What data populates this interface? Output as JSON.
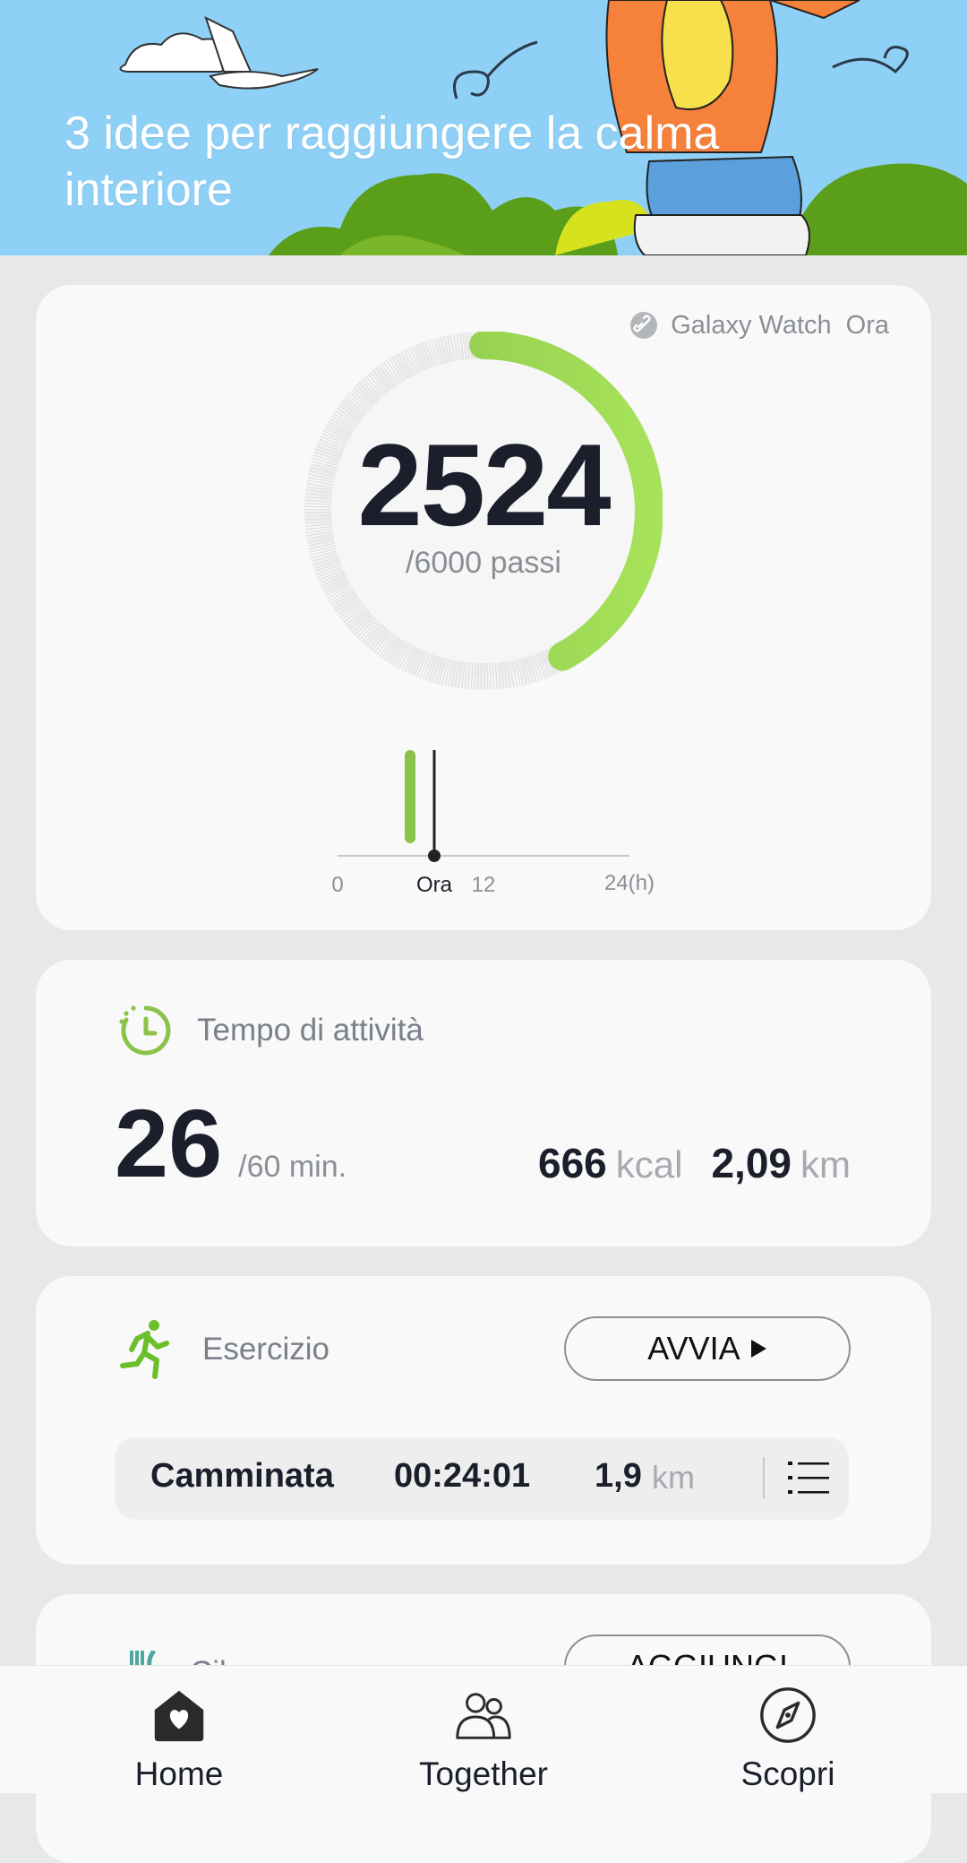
{
  "banner": {
    "headline": "3 idee per raggiungere la calma interiore",
    "colors": {
      "sky": "#8fd0f6",
      "bush": "#5a9e1a",
      "shirt": "#f5813a",
      "hair": "#f6e04b",
      "jeans": "#5ba0dc"
    }
  },
  "steps": {
    "source_device": "Galaxy Watch",
    "source_time": "Ora",
    "count": "2524",
    "goal_text": "/6000 passi",
    "progress": 0.4207,
    "timeline": {
      "labels": [
        "0",
        "Ora",
        "12",
        "24(h)"
      ],
      "now_hour": 7
    },
    "accent_color": "#8bc34a"
  },
  "active_time": {
    "title": "Tempo di attività",
    "value": "26",
    "goal_text": "/60 min.",
    "kcal_value": "666",
    "kcal_unit": "kcal",
    "distance_value": "2,09",
    "distance_unit": "km"
  },
  "exercise": {
    "title": "Esercizio",
    "start_label": "AVVIA",
    "last_workout": {
      "type": "Camminata",
      "duration": "00:24:01",
      "distance_value": "1,9",
      "distance_unit": "km"
    }
  },
  "food": {
    "title": "Cibo",
    "add_label": "AGGIUNGI"
  },
  "bottom_nav": [
    {
      "label": "Home",
      "icon": "home-heart-icon"
    },
    {
      "label": "Together",
      "icon": "people-icon"
    },
    {
      "label": "Scopri",
      "icon": "compass-icon"
    }
  ]
}
